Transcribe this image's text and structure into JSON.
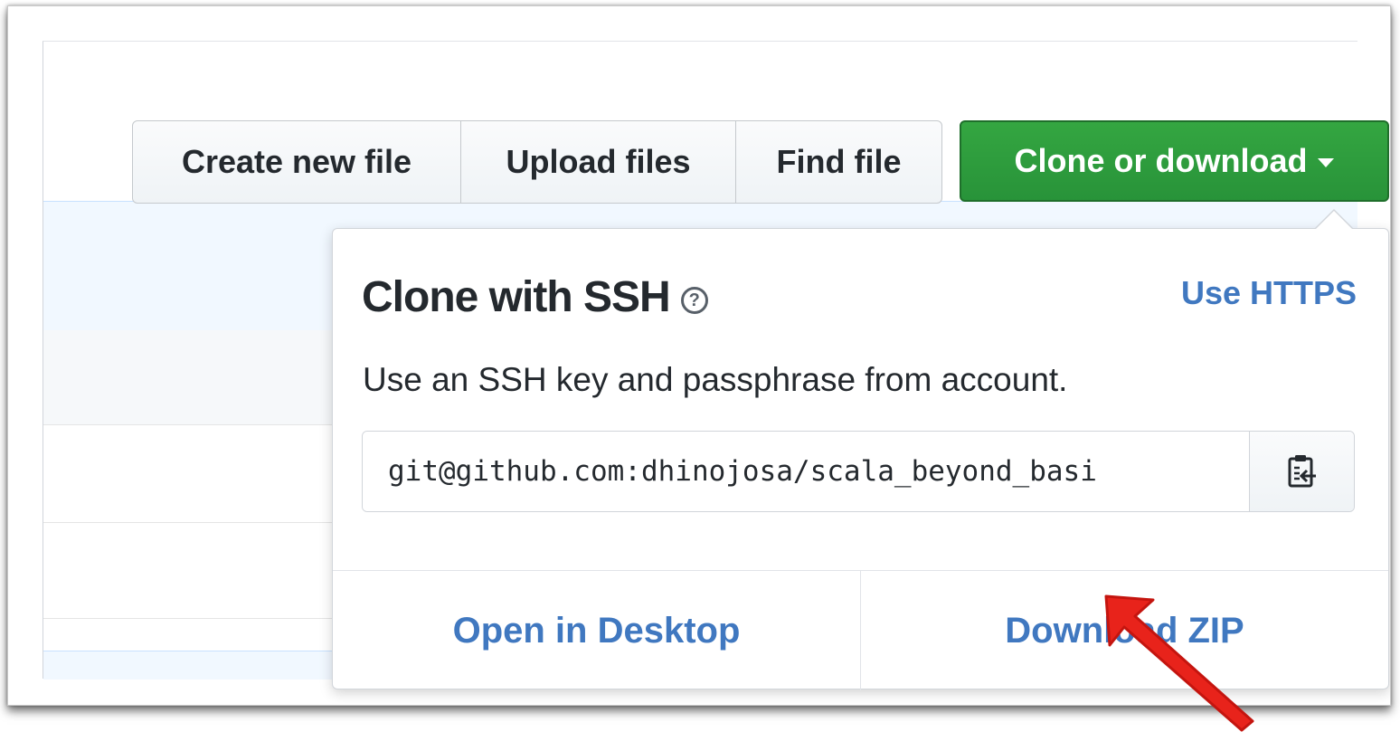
{
  "toolbar": {
    "create_new_file": "Create new file",
    "upload_files": "Upload files",
    "find_file": "Find file",
    "clone_or_download": "Clone or download"
  },
  "clone_dropdown": {
    "title": "Clone with SSH",
    "help_glyph": "?",
    "switch_protocol": "Use HTTPS",
    "description": "Use an SSH key and passphrase from account.",
    "clone_url": "git@github.com:dhinojosa/scala_beyond_basi",
    "open_in_desktop": "Open in Desktop",
    "download_zip": "Download ZIP"
  },
  "icons": {
    "help": "question-circle-icon",
    "copy": "clipboard-icon",
    "caret": "caret-down-icon",
    "annotation": "red-arrow-annotation"
  },
  "colors": {
    "clone_button": "#2c9a3c",
    "link": "#4078c0",
    "arrow": "#e8231b",
    "text": "#24292e"
  }
}
